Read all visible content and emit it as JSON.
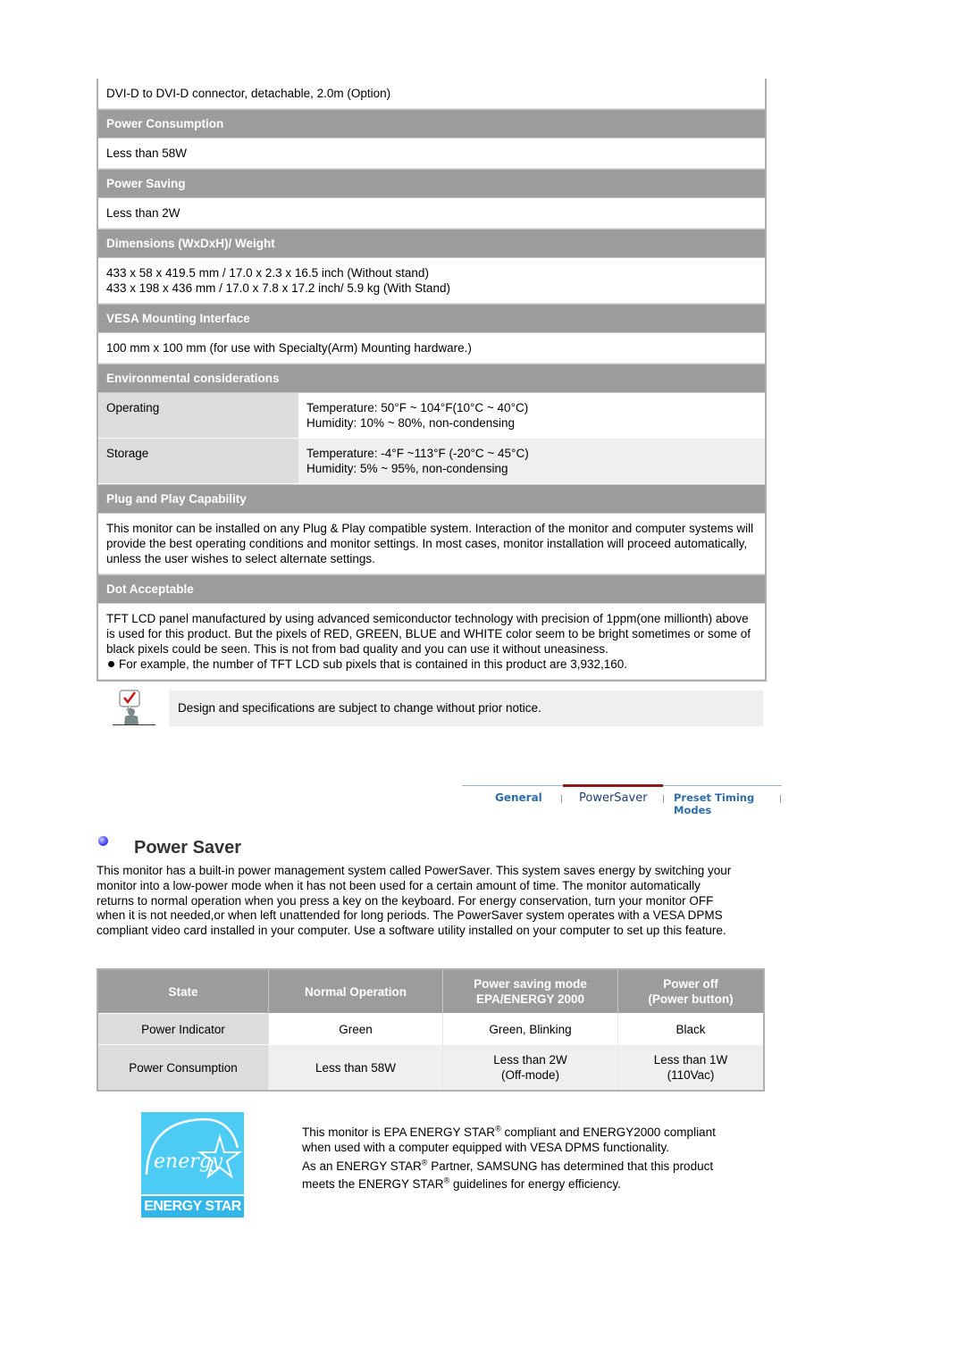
{
  "spec_table": {
    "connector_text": "DVI-D to DVI-D connector, detachable, 2.0m (Option)",
    "sections": {
      "power_consumption": {
        "heading": "Power Consumption",
        "value": "Less than 58W"
      },
      "power_saving": {
        "heading": "Power Saving",
        "value": "Less than 2W"
      },
      "dimensions": {
        "heading": "Dimensions (WxDxH)/ Weight",
        "line1": "433 x 58 x 419.5 mm / 17.0 x 2.3 x 16.5 inch (Without stand)",
        "line2": "433 x 198 x 436 mm / 17.0 x 7.8 x 17.2 inch/ 5.9 kg (With Stand)"
      },
      "vesa": {
        "heading": "VESA Mounting Interface",
        "value": "100 mm x 100 mm (for use with Specialty(Arm) Mounting hardware.)"
      },
      "environmental": {
        "heading": "Environmental considerations",
        "rows": [
          {
            "label": "Operating",
            "temperature": "Temperature: 50°F ~ 104°F(10°C ~ 40°C)",
            "humidity": "Humidity: 10% ~ 80%, non-condensing"
          },
          {
            "label": "Storage",
            "temperature": "Temperature: -4°F ~113°F (-20°C ~ 45°C)",
            "humidity": "Humidity: 5% ~ 95%, non-condensing"
          }
        ]
      },
      "plug_and_play": {
        "heading": "Plug and Play Capability",
        "value": "This monitor can be installed on any Plug & Play compatible system. Interaction of the monitor and computer systems will provide the best operating conditions and monitor settings. In most cases, monitor installation will proceed automatically, unless the user wishes to select alternate settings."
      },
      "dot_acceptable": {
        "heading": "Dot Acceptable",
        "value": "TFT LCD panel manufactured by using advanced semiconductor technology with precision of 1ppm(one millionth) above is used for this product. But the pixels of RED, GREEN, BLUE and WHITE color seem to be bright sometimes or some of black pixels could be seen. This is not from bad quality and you can use it without uneasiness.",
        "bullet": "For example, the number of TFT LCD sub pixels that is contained in this product are 3,932,160."
      }
    }
  },
  "notice": {
    "icon": "checkmark-note-icon",
    "text": "Design and specifications are subject to change without prior notice."
  },
  "tabs": {
    "items": [
      {
        "label": "General",
        "active": false
      },
      {
        "label": "PowerSaver",
        "active": true
      },
      {
        "label": "Preset Timing Modes",
        "active": false
      }
    ],
    "active_color": "#8b1a1a"
  },
  "power_saver": {
    "icon": "bullet-circle-icon",
    "title": "Power Saver",
    "description": "This monitor has a built-in power management system called PowerSaver. This system saves energy by switching your monitor into a low-power mode when it has not been used for a certain amount of time. The monitor automatically returns to normal operation when you press a key on the keyboard. For energy conservation, turn your monitor OFF when it is not needed,or when left unattended for long periods. The PowerSaver system operates with a VESA DPMS compliant video card installed in your computer. Use a software utility installed on your computer to set up this feature."
  },
  "state_table": {
    "headers": [
      {
        "line1": "State",
        "line2": ""
      },
      {
        "line1": "Normal Operation",
        "line2": ""
      },
      {
        "line1": "Power saving mode",
        "line2": "EPA/ENERGY 2000"
      },
      {
        "line1": "Power off",
        "line2": "(Power button)"
      }
    ],
    "rows": [
      {
        "cells": [
          {
            "line1": "Power Indicator",
            "line2": ""
          },
          {
            "line1": "Green",
            "line2": ""
          },
          {
            "line1": "Green, Blinking",
            "line2": ""
          },
          {
            "line1": "Black",
            "line2": ""
          }
        ]
      },
      {
        "cells": [
          {
            "line1": "Power Consumption",
            "line2": ""
          },
          {
            "line1": "Less than 58W",
            "line2": ""
          },
          {
            "line1": "Less than 2W",
            "line2": "(Off-mode)"
          },
          {
            "line1": "Less than 1W",
            "line2": "(110Vac)"
          }
        ]
      }
    ]
  },
  "energy_star": {
    "logo_script": "energy",
    "logo_label": "ENERGY STAR",
    "logo_color": "#4ccbf5",
    "para1_a": "This monitor is EPA ENERGY STAR",
    "para1_b": " compliant and ENERGY2000 compliant when used with a computer equipped with VESA DPMS functionality.",
    "para2_a": "As an ENERGY STAR",
    "para2_b": " Partner, SAMSUNG has determined that this product meets the ENERGY STAR",
    "para2_c": " guidelines for energy efficiency.",
    "registered_mark": "®"
  }
}
